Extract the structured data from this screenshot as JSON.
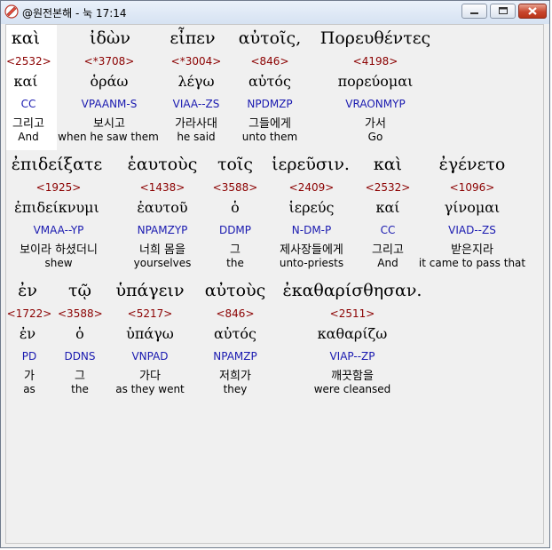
{
  "window": {
    "title": "@원전본해 - 눅 17:14"
  },
  "rows": [
    [
      {
        "greek": "καὶ",
        "strong": "<2532>",
        "lemma": "καί",
        "parse": "CC",
        "korean": "그리고",
        "english": "And"
      },
      {
        "greek": "ἰδὼν",
        "strong": "<*3708>",
        "lemma": "ὁράω",
        "parse": "VPAANM-S",
        "korean": "보시고",
        "english": "when he saw them"
      },
      {
        "greek": "εἶπεν",
        "strong": "<*3004>",
        "lemma": "λέγω",
        "parse": "VIAA--ZS",
        "korean": "가라사대",
        "english": "he said"
      },
      {
        "greek": "αὐτοῖς,",
        "strong": "<846>",
        "lemma": "αὐτός",
        "parse": "NPDMZP",
        "korean": "그들에게",
        "english": "unto them"
      },
      {
        "greek": "Πορευθέντες",
        "strong": "<4198>",
        "lemma": "πορεύομαι",
        "parse": "VRAONMYP",
        "korean": "가서",
        "english": "Go"
      }
    ],
    [
      {
        "greek": "ἐπιδείξατε",
        "strong": "<1925>",
        "lemma": "ἐπιδείκνυμι",
        "parse": "VMAA--YP",
        "korean": "보이라 하셨더니",
        "english": "shew"
      },
      {
        "greek": "ἑαυτοὺς",
        "strong": "<1438>",
        "lemma": "ἑαυτοῦ",
        "parse": "NPAMZYP",
        "korean": "너희 몸을",
        "english": "yourselves"
      },
      {
        "greek": "τοῖς",
        "strong": "<3588>",
        "lemma": "ὁ",
        "parse": "DDMP",
        "korean": "그",
        "english": "the"
      },
      {
        "greek": "ἱερεῦσιν.",
        "strong": "<2409>",
        "lemma": "ἱερεύς",
        "parse": "N-DM-P",
        "korean": "제사장들에게",
        "english": "unto-priests"
      },
      {
        "greek": "καὶ",
        "strong": "<2532>",
        "lemma": "καί",
        "parse": "CC",
        "korean": "그리고",
        "english": "And"
      },
      {
        "greek": "ἐγένετο",
        "strong": "<1096>",
        "lemma": "γίνομαι",
        "parse": "VIAD--ZS",
        "korean": "받은지라",
        "english": "it came to pass that"
      }
    ],
    [
      {
        "greek": "ἐν",
        "strong": "<1722>",
        "lemma": "ἐν",
        "parse": "PD",
        "korean": "가",
        "english": "as"
      },
      {
        "greek": "τῷ",
        "strong": "<3588>",
        "lemma": "ὁ",
        "parse": "DDNS",
        "korean": "그",
        "english": "the"
      },
      {
        "greek": "ὑπάγειν",
        "strong": "<5217>",
        "lemma": "ὑπάγω",
        "parse": "VNPAD",
        "korean": "가다",
        "english": "as they went"
      },
      {
        "greek": "αὐτοὺς",
        "strong": "<846>",
        "lemma": "αὐτός",
        "parse": "NPAMZP",
        "korean": "저희가",
        "english": "they"
      },
      {
        "greek": "ἐκαθαρίσθησαν.",
        "strong": "<2511>",
        "lemma": "καθαρίζω",
        "parse": "VIAP--ZP",
        "korean": "깨끗함을",
        "english": "were cleansed"
      }
    ]
  ]
}
